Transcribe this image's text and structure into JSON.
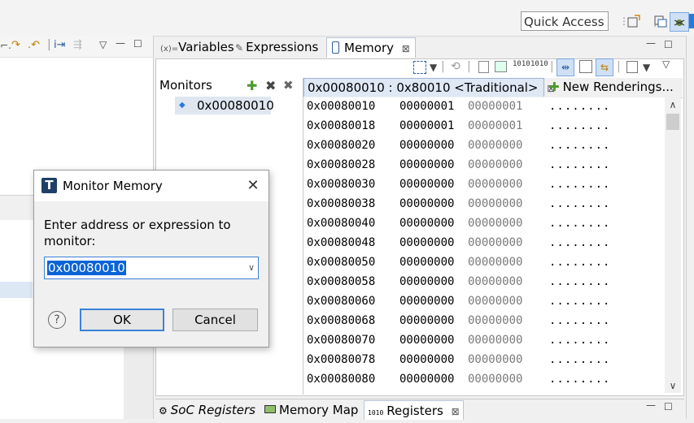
{
  "topbar": {
    "quick_access_placeholder": "Quick Access"
  },
  "views": {
    "tabs": [
      {
        "label": "Variables",
        "icon": "variables-icon",
        "prefix": "(x)="
      },
      {
        "label": "Expressions",
        "icon": "expressions-icon"
      },
      {
        "label": "Memory",
        "icon": "memory-icon",
        "active": true
      }
    ]
  },
  "monitors": {
    "label": "Monitors",
    "items": [
      {
        "label": "0x00080010"
      }
    ]
  },
  "renderings": {
    "tabs": [
      {
        "label": "0x00080010 : 0x80010 <Traditional>",
        "active": true
      },
      {
        "label": "New Renderings..."
      }
    ]
  },
  "memory": {
    "rows": [
      {
        "addr": "0x00080010",
        "w1": "00000001",
        "w2": "00000001",
        "ascii": "........"
      },
      {
        "addr": "0x00080018",
        "w1": "00000001",
        "w2": "00000001",
        "ascii": "........"
      },
      {
        "addr": "0x00080020",
        "w1": "00000000",
        "w2": "00000000",
        "ascii": "........"
      },
      {
        "addr": "0x00080028",
        "w1": "00000000",
        "w2": "00000000",
        "ascii": "........"
      },
      {
        "addr": "0x00080030",
        "w1": "00000000",
        "w2": "00000000",
        "ascii": "........"
      },
      {
        "addr": "0x00080038",
        "w1": "00000000",
        "w2": "00000000",
        "ascii": "........"
      },
      {
        "addr": "0x00080040",
        "w1": "00000000",
        "w2": "00000000",
        "ascii": "........"
      },
      {
        "addr": "0x00080048",
        "w1": "00000000",
        "w2": "00000000",
        "ascii": "........"
      },
      {
        "addr": "0x00080050",
        "w1": "00000000",
        "w2": "00000000",
        "ascii": "........"
      },
      {
        "addr": "0x00080058",
        "w1": "00000000",
        "w2": "00000000",
        "ascii": "........"
      },
      {
        "addr": "0x00080060",
        "w1": "00000000",
        "w2": "00000000",
        "ascii": "........"
      },
      {
        "addr": "0x00080068",
        "w1": "00000000",
        "w2": "00000000",
        "ascii": "........"
      },
      {
        "addr": "0x00080070",
        "w1": "00000000",
        "w2": "00000000",
        "ascii": "........"
      },
      {
        "addr": "0x00080078",
        "w1": "00000000",
        "w2": "00000000",
        "ascii": "........"
      },
      {
        "addr": "0x00080080",
        "w1": "00000000",
        "w2": "00000000",
        "ascii": "........"
      }
    ]
  },
  "bottom": {
    "tabs": [
      {
        "label": "SoC Registers",
        "icon": "soc-registers-icon"
      },
      {
        "label": "Memory Map",
        "icon": "memory-map-icon"
      },
      {
        "label": "Registers",
        "icon": "registers-icon",
        "active": true
      }
    ]
  },
  "dialog": {
    "title": "Monitor Memory",
    "prompt": "Enter address or expression to monitor:",
    "value": "0x00080010",
    "ok_label": "OK",
    "cancel_label": "Cancel",
    "help_glyph": "?"
  },
  "colors": {
    "accent": "#3b82d6",
    "selection": "#0a64d6",
    "ascii_dim": "#7a7a7a"
  }
}
